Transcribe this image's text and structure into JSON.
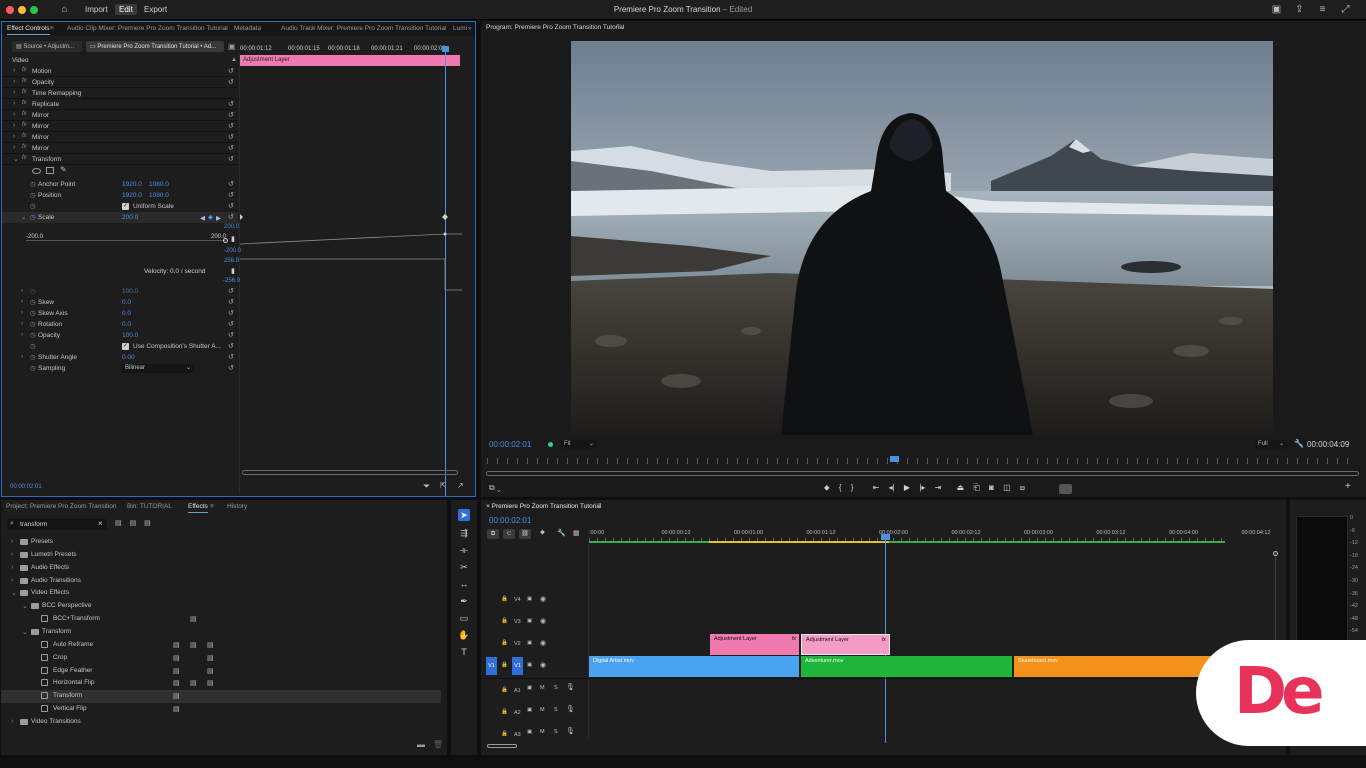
{
  "menu": {
    "import": "Import",
    "edit": "Edit",
    "export": "Export"
  },
  "app_title": "Premiere Pro Zoom Transition",
  "app_status": "– Edited",
  "effect_controls": {
    "tabs": [
      "Effect Controls",
      "Audio Clip Mixer: Premiere Pro Zoom Transition Tutorial",
      "Metadata",
      "Audio Track Mixer: Premiere Pro Zoom Transition Tutorial",
      "Lumi"
    ],
    "source_tab": "Source • Adjustm...",
    "sequence_tab": "Premiere Pro Zoom Transition Tutorial • Ad...",
    "ruler": [
      "00:00:01:12",
      "00:00:01:15",
      "00:00:01:18",
      "00:00:01:21",
      "00:00:02:00"
    ],
    "clip_bar": "Adjustment Layer",
    "video_header": "Video",
    "effects": [
      "Motion",
      "Opacity",
      "Time Remapping",
      "Replicate",
      "Mirror",
      "Mirror",
      "Mirror",
      "Mirror",
      "Transform"
    ],
    "anchor_point": {
      "label": "Anchor Point",
      "x": "1920.0",
      "y": "1080.0"
    },
    "position": {
      "label": "Position",
      "x": "1920.0",
      "y": "1080.0"
    },
    "uniform_scale": "Uniform Scale",
    "scale": {
      "label": "Scale",
      "value": "200.0"
    },
    "graph_left": "-200.0",
    "graph_right": "200.0",
    "graph_values": [
      "200.0",
      "-200.0",
      "256.9"
    ],
    "velocity": "Velocity: 0.0 / second",
    "velocity_value": "-256.9",
    "scale_width": "100.0",
    "skew": {
      "label": "Skew",
      "value": "0.0"
    },
    "skew_axis": {
      "label": "Skew Axis",
      "value": "0.0"
    },
    "rotation": {
      "label": "Rotation",
      "value": "0.0"
    },
    "opacity": {
      "label": "Opacity",
      "value": "100.0"
    },
    "use_comp_shutter": "Use Composition's Shutter A...",
    "shutter_angle": {
      "label": "Shutter Angle",
      "value": "0.00"
    },
    "sampling": {
      "label": "Sampling",
      "value": "Bilinear"
    },
    "timecode": "00:00:02:01"
  },
  "program": {
    "title": "Program: Premiere Pro Zoom Transition Tutorial",
    "timecode": "00:00:02:01",
    "fit": "Fit",
    "quality": "Full",
    "duration": "00:00:04:09"
  },
  "project": {
    "tabs": [
      "Project: Premiere Pro Zoom Transition",
      "Bin: TUTORIAL",
      "Effects",
      "History"
    ],
    "search_value": "transform",
    "tree": [
      {
        "label": "Presets",
        "depth": 0,
        "open": false,
        "type": "folder"
      },
      {
        "label": "Lumetri Presets",
        "depth": 0,
        "open": false,
        "type": "folder"
      },
      {
        "label": "Audio Effects",
        "depth": 0,
        "open": false,
        "type": "folder"
      },
      {
        "label": "Audio Transitions",
        "depth": 0,
        "open": false,
        "type": "folder"
      },
      {
        "label": "Video Effects",
        "depth": 0,
        "open": true,
        "type": "folder"
      },
      {
        "label": "BCC Perspective",
        "depth": 1,
        "open": true,
        "type": "folder"
      },
      {
        "label": "BCC+Transform",
        "depth": 2,
        "type": "effect"
      },
      {
        "label": "Transform",
        "depth": 1,
        "open": true,
        "type": "folder"
      },
      {
        "label": "Auto Reframe",
        "depth": 2,
        "type": "effect"
      },
      {
        "label": "Crop",
        "depth": 2,
        "type": "effect"
      },
      {
        "label": "Edge Feather",
        "depth": 2,
        "type": "effect"
      },
      {
        "label": "Horizontal Flip",
        "depth": 2,
        "type": "effect"
      },
      {
        "label": "Transform",
        "depth": 2,
        "type": "effect",
        "selected": true
      },
      {
        "label": "Vertical Flip",
        "depth": 2,
        "type": "effect"
      },
      {
        "label": "Video Transitions",
        "depth": 0,
        "open": false,
        "type": "folder"
      }
    ]
  },
  "timeline": {
    "title": "Premiere Pro Zoom Transition Tutorial",
    "timecode": "00:00:02:01",
    "ruler": [
      ":00:00",
      "00:00:00:12",
      "00:00:01:00",
      "00:00:01:12",
      "00:00:02:00",
      "00:00:02:12",
      "00:00:03:00",
      "00:00:03:12",
      "00:00:04:00",
      "00:00:04:12"
    ],
    "tracks": {
      "v4": "V4",
      "v3": "V3",
      "v2": "V2",
      "v1": "V1",
      "a1": "A1",
      "a2": "A2",
      "a3": "A3",
      "src_v1": "V1"
    },
    "mute": "M",
    "solo": "S",
    "clips": {
      "adj1": "Adjustment Layer",
      "adj2": "Adjustment Layer",
      "digital": "Digital Artist.mov",
      "adventurer": "Adventurer.mov",
      "skateboard": "Skateboard.mov"
    },
    "fx_badge": "fx"
  },
  "meter": {
    "scale": [
      "0",
      "-6",
      "-12",
      "-18",
      "-24",
      "-30",
      "-36",
      "-42",
      "-48",
      "-54"
    ]
  },
  "watermark": "De"
}
